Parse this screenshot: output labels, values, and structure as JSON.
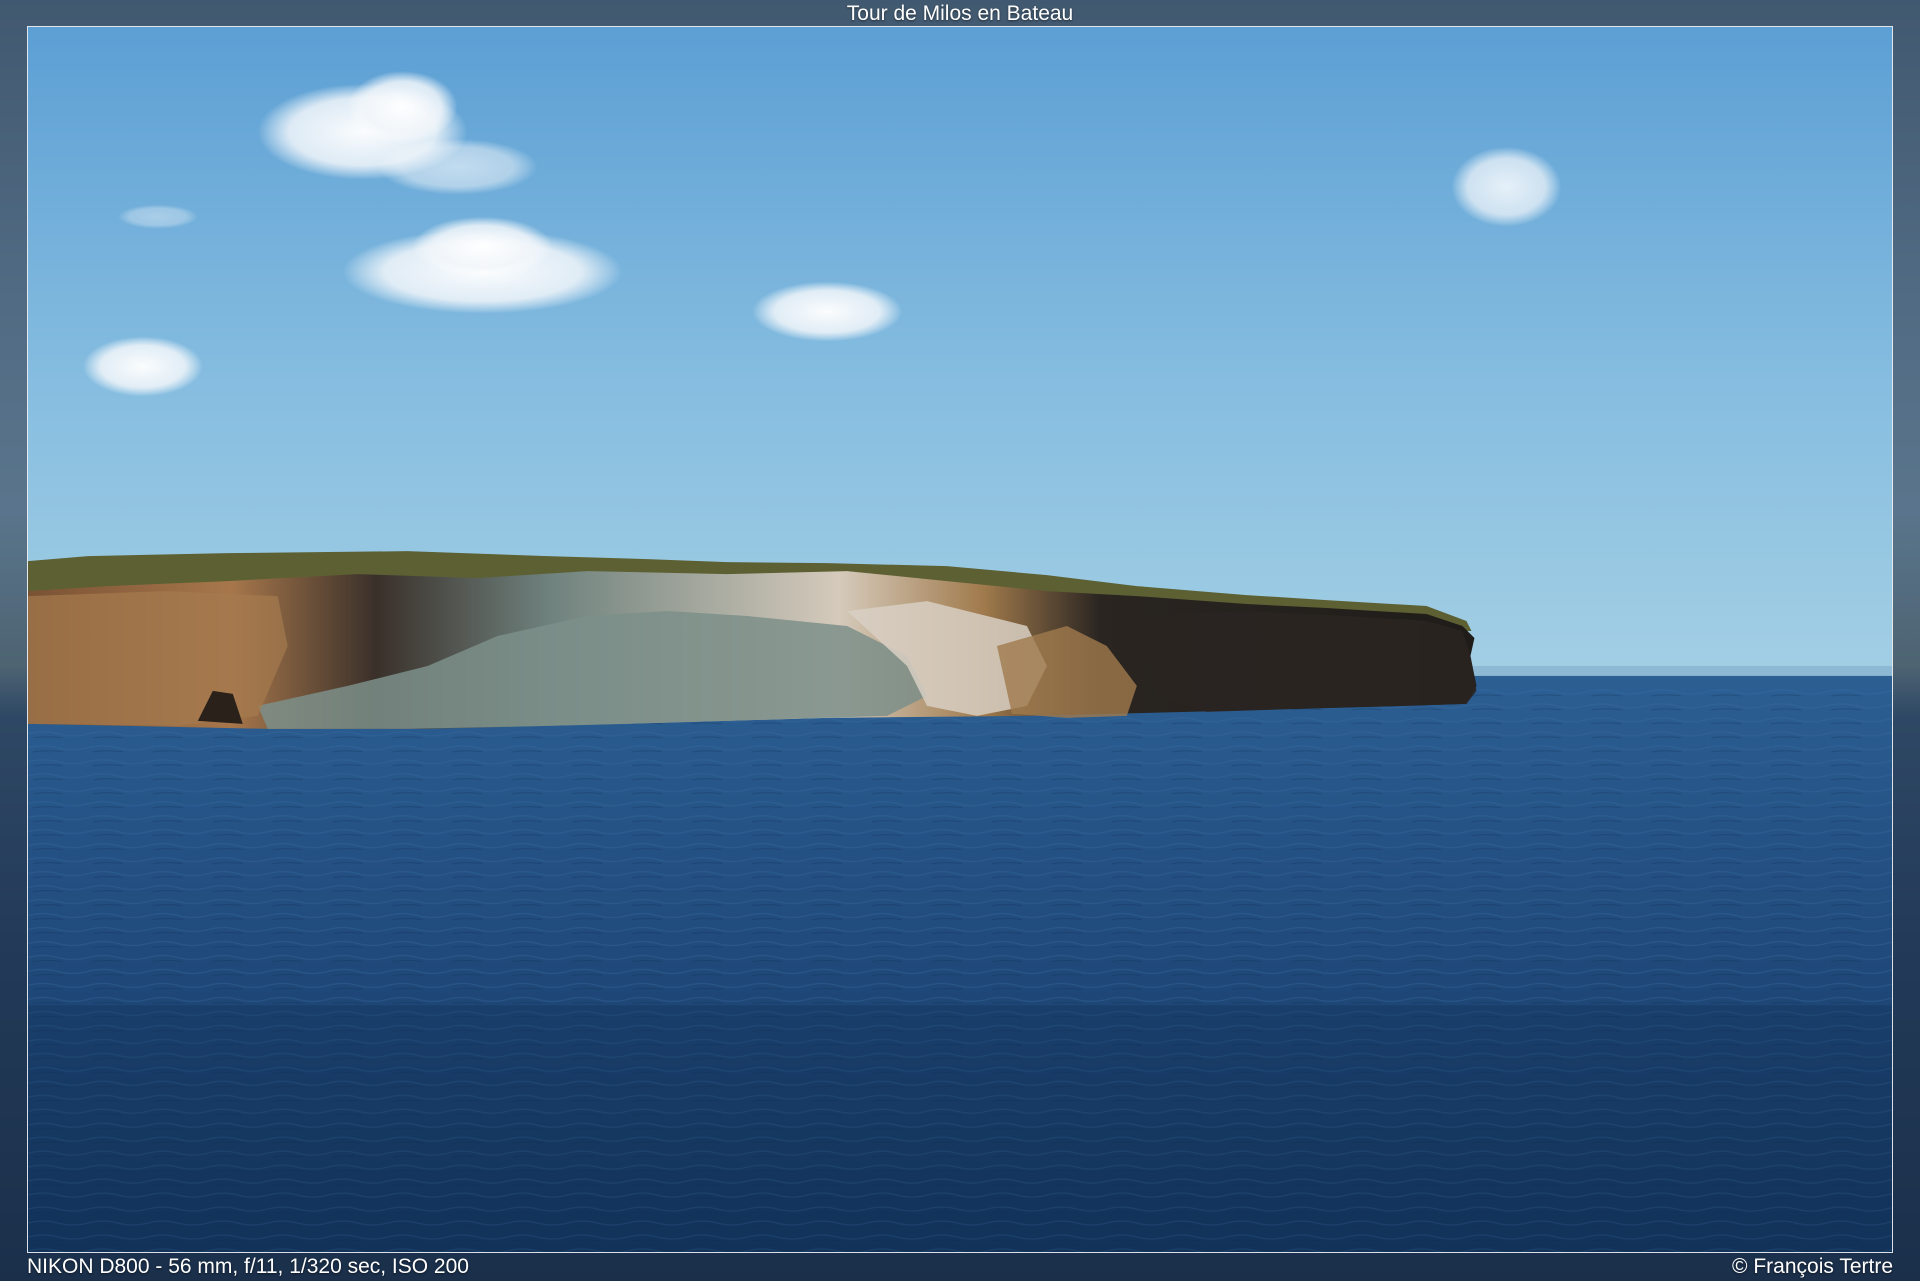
{
  "viewer": {
    "title": "Tour de Milos en Bateau",
    "exif": "NIKON D800 - 56 mm, f/11, 1/320 sec, ISO 200",
    "copyright": "© François Tertre"
  },
  "photo": {
    "subject": "coastline-seascape",
    "colors": {
      "sky_top": "#5a9fd4",
      "sky_bottom": "#9cc8e2",
      "sea_horizon": "#2a5c91",
      "sea_bottom": "#143763",
      "cliff_dark": "#2b2620",
      "cliff_ochre": "#a8764a",
      "cliff_grey_green": "#7d8f8a",
      "cliff_pale": "#d9cfc2",
      "vegetation": "#5e6234"
    }
  }
}
